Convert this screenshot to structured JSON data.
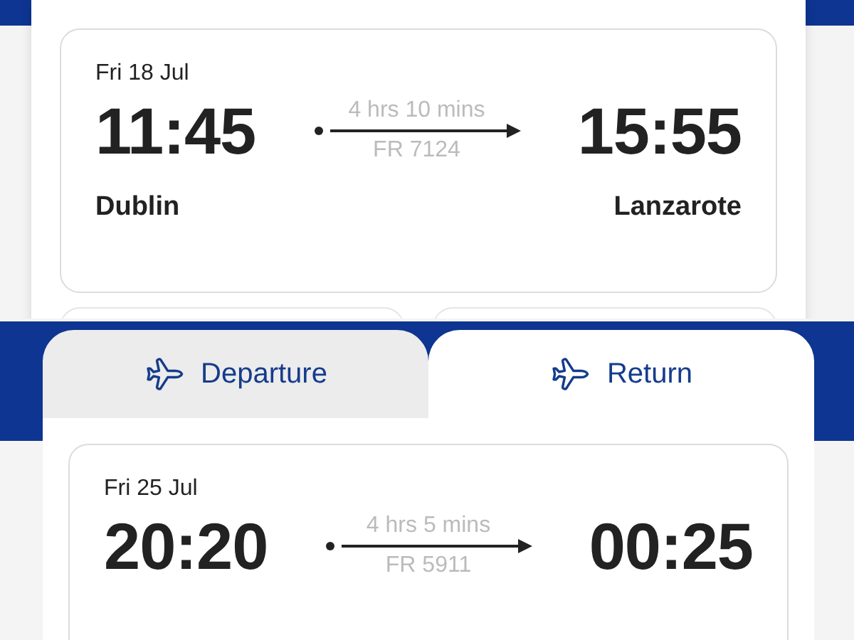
{
  "outbound": {
    "date": "Fri 18 Jul",
    "depart_time": "11:45",
    "arrive_time": "15:55",
    "duration": "4 hrs 10 mins",
    "flight_number": "FR 7124",
    "origin": "Dublin",
    "destination": "Lanzarote"
  },
  "tabs": [
    {
      "label": "Departure",
      "selected": false
    },
    {
      "label": "Return",
      "selected": true
    }
  ],
  "return": {
    "date": "Fri 25 Jul",
    "depart_time": "20:20",
    "arrive_time": "00:25",
    "duration": "4 hrs 5 mins",
    "flight_number": "FR 5911"
  }
}
